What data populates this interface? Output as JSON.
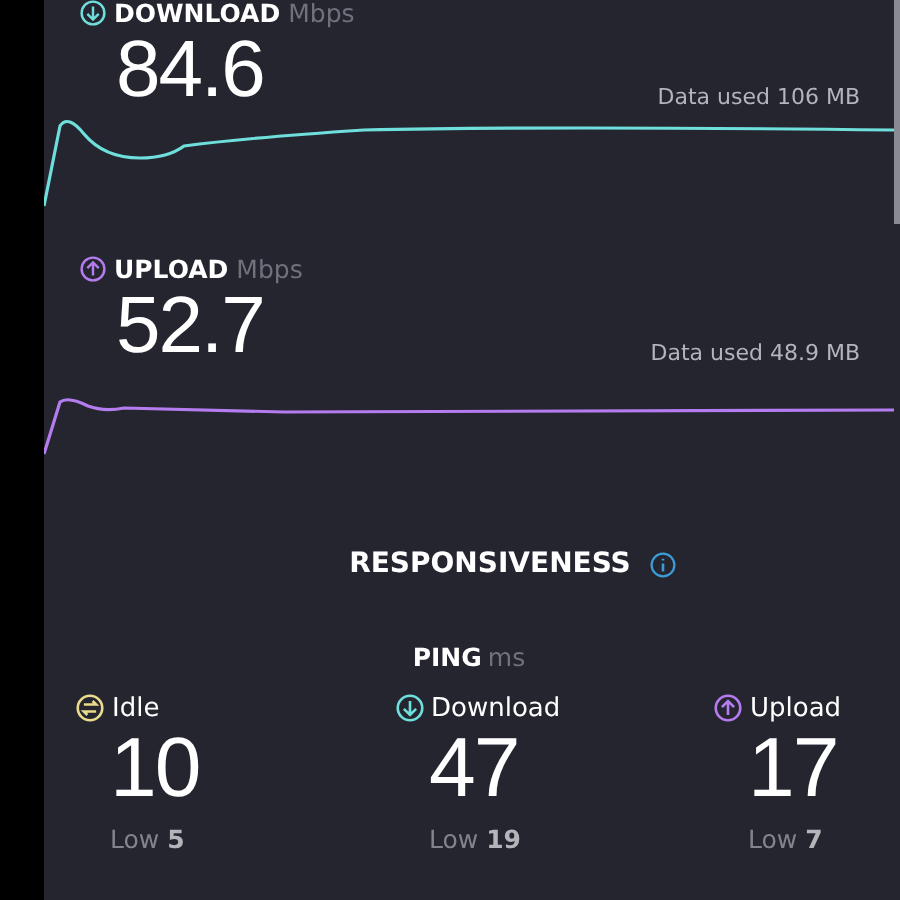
{
  "download": {
    "label": "DOWNLOAD",
    "unit": "Mbps",
    "value": "84.6",
    "data_used": "Data used 106 MB"
  },
  "upload": {
    "label": "UPLOAD",
    "unit": "Mbps",
    "value": "52.7",
    "data_used": "Data used 48.9 MB"
  },
  "responsiveness": {
    "title": "RESPONSIVENESS"
  },
  "ping": {
    "label": "PING",
    "unit": "ms",
    "items": [
      {
        "kind": "idle",
        "label": "Idle",
        "value": "10",
        "low_label": "Low",
        "low": "5"
      },
      {
        "kind": "download",
        "label": "Download",
        "value": "47",
        "low_label": "Low",
        "low": "19"
      },
      {
        "kind": "upload",
        "label": "Upload",
        "value": "17",
        "low_label": "Low",
        "low": "7"
      }
    ]
  }
}
